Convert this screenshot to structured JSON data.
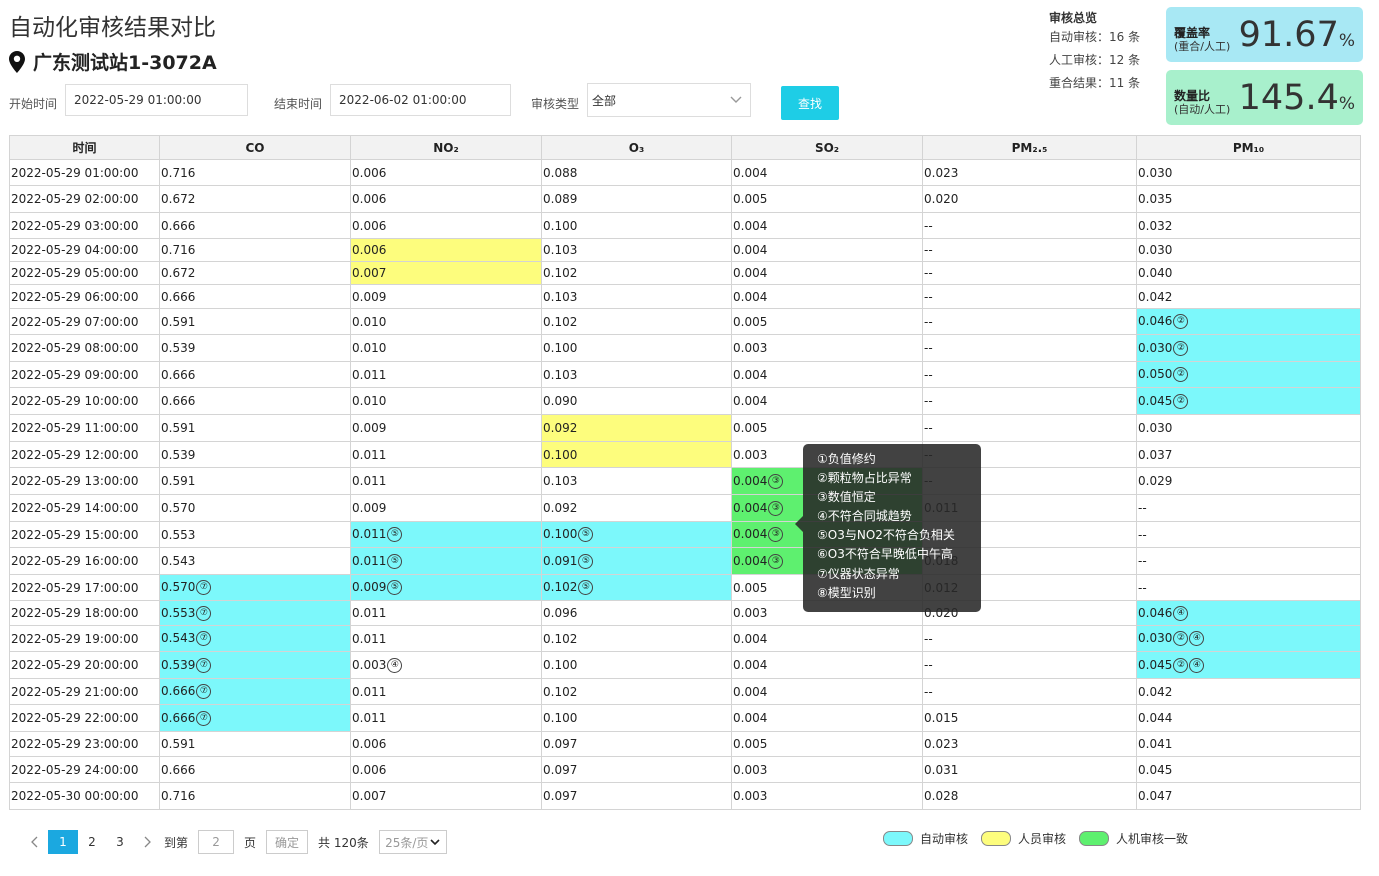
{
  "header": {
    "title": "自动化审核结果对比",
    "station": "广东测试站1-3072A"
  },
  "filters": {
    "start_label": "开始时间",
    "start_value": "2022-05-29 01:00:00",
    "end_label": "结束时间",
    "end_value": "2022-06-02 01:00:00",
    "type_label": "审核类型",
    "type_value": "全部",
    "search_label": "查找"
  },
  "summary": {
    "heading": "审核总览",
    "auto": "自动审核：16 条",
    "manual": "人工审核：12 条",
    "overlap": "重合结果：11 条"
  },
  "cards": {
    "coverage_label": "覆盖率",
    "coverage_sub": "(重合/人工)",
    "coverage_value": "91.67",
    "coverage_unit": "%",
    "coverage_color": "#a8e8f4",
    "ratio_label": "数量比",
    "ratio_sub": "(自动/人工)",
    "ratio_value": "145.4",
    "ratio_unit": "%",
    "ratio_color": "#a8f0cc"
  },
  "table": {
    "columns": [
      "时间",
      "CO",
      "NO₂",
      "O₃",
      "SO₂",
      "PM₂.₅",
      "PM₁₀"
    ],
    "rows": [
      {
        "time": "2022-05-29 01:00:00",
        "cells": [
          [
            "0.716",
            "",
            []
          ],
          [
            "0.006",
            "",
            []
          ],
          [
            "0.088",
            "",
            []
          ],
          [
            "0.004",
            "",
            []
          ],
          [
            "0.023",
            "",
            []
          ],
          [
            "0.030",
            "",
            []
          ]
        ]
      },
      {
        "time": "2022-05-29 02:00:00",
        "cells": [
          [
            "0.672",
            "",
            []
          ],
          [
            "0.006",
            "",
            []
          ],
          [
            "0.089",
            "",
            []
          ],
          [
            "0.005",
            "",
            []
          ],
          [
            "0.020",
            "",
            []
          ],
          [
            "0.035",
            "",
            []
          ]
        ]
      },
      {
        "time": "2022-05-29 03:00:00",
        "cells": [
          [
            "0.666",
            "",
            []
          ],
          [
            "0.006",
            "",
            []
          ],
          [
            "0.100",
            "",
            []
          ],
          [
            "0.004",
            "",
            []
          ],
          [
            "--",
            "",
            []
          ],
          [
            "0.032",
            "",
            []
          ]
        ]
      },
      {
        "time": "2022-05-29 04:00:00",
        "cells": [
          [
            "0.716",
            "",
            []
          ],
          [
            "0.006",
            "y",
            []
          ],
          [
            "0.103",
            "",
            []
          ],
          [
            "0.004",
            "",
            []
          ],
          [
            "--",
            "",
            []
          ],
          [
            "0.030",
            "",
            []
          ]
        ]
      },
      {
        "time": "2022-05-29 05:00:00",
        "cells": [
          [
            "0.672",
            "",
            []
          ],
          [
            "0.007",
            "y",
            []
          ],
          [
            "0.102",
            "",
            []
          ],
          [
            "0.004",
            "",
            []
          ],
          [
            "--",
            "",
            []
          ],
          [
            "0.040",
            "",
            []
          ]
        ]
      },
      {
        "time": "2022-05-29 06:00:00",
        "cells": [
          [
            "0.666",
            "",
            []
          ],
          [
            "0.009",
            "",
            []
          ],
          [
            "0.103",
            "",
            []
          ],
          [
            "0.004",
            "",
            []
          ],
          [
            "--",
            "",
            []
          ],
          [
            "0.042",
            "",
            []
          ]
        ]
      },
      {
        "time": "2022-05-29 07:00:00",
        "cells": [
          [
            "0.591",
            "",
            []
          ],
          [
            "0.010",
            "",
            []
          ],
          [
            "0.102",
            "",
            []
          ],
          [
            "0.005",
            "",
            []
          ],
          [
            "--",
            "",
            []
          ],
          [
            "0.046",
            "c",
            [
              "②"
            ]
          ]
        ]
      },
      {
        "time": "2022-05-29 08:00:00",
        "cells": [
          [
            "0.539",
            "",
            []
          ],
          [
            "0.010",
            "",
            []
          ],
          [
            "0.100",
            "",
            []
          ],
          [
            "0.003",
            "",
            []
          ],
          [
            "--",
            "",
            []
          ],
          [
            "0.030",
            "c",
            [
              "②"
            ]
          ]
        ]
      },
      {
        "time": "2022-05-29 09:00:00",
        "cells": [
          [
            "0.666",
            "",
            []
          ],
          [
            "0.011",
            "",
            []
          ],
          [
            "0.103",
            "",
            []
          ],
          [
            "0.004",
            "",
            []
          ],
          [
            "--",
            "",
            []
          ],
          [
            "0.050",
            "c",
            [
              "②"
            ]
          ]
        ]
      },
      {
        "time": "2022-05-29 10:00:00",
        "cells": [
          [
            "0.666",
            "",
            []
          ],
          [
            "0.010",
            "",
            []
          ],
          [
            "0.090",
            "",
            []
          ],
          [
            "0.004",
            "",
            []
          ],
          [
            "--",
            "",
            []
          ],
          [
            "0.045",
            "c",
            [
              "②"
            ]
          ]
        ]
      },
      {
        "time": "2022-05-29 11:00:00",
        "cells": [
          [
            "0.591",
            "",
            []
          ],
          [
            "0.009",
            "",
            []
          ],
          [
            "0.092",
            "y",
            []
          ],
          [
            "0.005",
            "",
            []
          ],
          [
            "--",
            "",
            []
          ],
          [
            "0.030",
            "",
            []
          ]
        ]
      },
      {
        "time": "2022-05-29 12:00:00",
        "cells": [
          [
            "0.539",
            "",
            []
          ],
          [
            "0.011",
            "",
            []
          ],
          [
            "0.100",
            "y",
            []
          ],
          [
            "0.003",
            "",
            []
          ],
          [
            "--",
            "",
            []
          ],
          [
            "0.037",
            "",
            []
          ]
        ]
      },
      {
        "time": "2022-05-29 13:00:00",
        "cells": [
          [
            "0.591",
            "",
            []
          ],
          [
            "0.011",
            "",
            []
          ],
          [
            "0.103",
            "",
            []
          ],
          [
            "0.004",
            "g",
            [
              "③"
            ]
          ],
          [
            "--",
            "",
            []
          ],
          [
            "0.029",
            "",
            []
          ]
        ]
      },
      {
        "time": "2022-05-29 14:00:00",
        "cells": [
          [
            "0.570",
            "",
            []
          ],
          [
            "0.009",
            "",
            []
          ],
          [
            "0.092",
            "",
            []
          ],
          [
            "0.004",
            "g",
            [
              "③"
            ]
          ],
          [
            "0.011",
            "",
            []
          ],
          [
            "--",
            "",
            []
          ]
        ]
      },
      {
        "time": "2022-05-29 15:00:00",
        "cells": [
          [
            "0.553",
            "",
            []
          ],
          [
            "0.011",
            "c",
            [
              "⑤"
            ]
          ],
          [
            "0.100",
            "c",
            [
              "⑤"
            ]
          ],
          [
            "0.004",
            "g",
            [
              "③"
            ]
          ],
          [
            "--",
            "",
            []
          ],
          [
            "--",
            "",
            []
          ]
        ]
      },
      {
        "time": "2022-05-29 16:00:00",
        "cells": [
          [
            "0.543",
            "",
            []
          ],
          [
            "0.011",
            "c",
            [
              "⑤"
            ]
          ],
          [
            "0.091",
            "c",
            [
              "⑤"
            ]
          ],
          [
            "0.004",
            "g",
            [
              "③"
            ]
          ],
          [
            "0.018",
            "",
            []
          ],
          [
            "--",
            "",
            []
          ]
        ]
      },
      {
        "time": "2022-05-29 17:00:00",
        "cells": [
          [
            "0.570",
            "c",
            [
              "⑦"
            ]
          ],
          [
            "0.009",
            "c",
            [
              "⑤"
            ]
          ],
          [
            "0.102",
            "c",
            [
              "⑤"
            ]
          ],
          [
            "0.005",
            "",
            []
          ],
          [
            "0.012",
            "",
            []
          ],
          [
            "--",
            "",
            []
          ]
        ]
      },
      {
        "time": "2022-05-29 18:00:00",
        "cells": [
          [
            "0.553",
            "c",
            [
              "⑦"
            ]
          ],
          [
            "0.011",
            "",
            []
          ],
          [
            "0.096",
            "",
            []
          ],
          [
            "0.003",
            "",
            []
          ],
          [
            "0.020",
            "",
            []
          ],
          [
            "0.046",
            "c",
            [
              "④"
            ]
          ]
        ]
      },
      {
        "time": "2022-05-29 19:00:00",
        "cells": [
          [
            "0.543",
            "c",
            [
              "⑦"
            ]
          ],
          [
            "0.011",
            "",
            []
          ],
          [
            "0.102",
            "",
            []
          ],
          [
            "0.004",
            "",
            []
          ],
          [
            "--",
            "",
            []
          ],
          [
            "0.030",
            "c",
            [
              "②",
              "④"
            ]
          ]
        ]
      },
      {
        "time": "2022-05-29 20:00:00",
        "cells": [
          [
            "0.539",
            "c",
            [
              "⑦"
            ]
          ],
          [
            "0.003",
            "",
            [
              "④"
            ]
          ],
          [
            "0.100",
            "",
            []
          ],
          [
            "0.004",
            "",
            []
          ],
          [
            "--",
            "",
            []
          ],
          [
            "0.045",
            "c",
            [
              "②",
              "④"
            ]
          ]
        ]
      },
      {
        "time": "2022-05-29 21:00:00",
        "cells": [
          [
            "0.666",
            "c",
            [
              "⑦"
            ]
          ],
          [
            "0.011",
            "",
            []
          ],
          [
            "0.102",
            "",
            []
          ],
          [
            "0.004",
            "",
            []
          ],
          [
            "--",
            "",
            []
          ],
          [
            "0.042",
            "",
            []
          ]
        ]
      },
      {
        "time": "2022-05-29 22:00:00",
        "cells": [
          [
            "0.666",
            "c",
            [
              "⑦"
            ]
          ],
          [
            "0.011",
            "",
            []
          ],
          [
            "0.100",
            "",
            []
          ],
          [
            "0.004",
            "",
            []
          ],
          [
            "0.015",
            "",
            []
          ],
          [
            "0.044",
            "",
            []
          ]
        ]
      },
      {
        "time": "2022-05-29 23:00:00",
        "cells": [
          [
            "0.591",
            "",
            []
          ],
          [
            "0.006",
            "",
            []
          ],
          [
            "0.097",
            "",
            []
          ],
          [
            "0.005",
            "",
            []
          ],
          [
            "0.023",
            "",
            []
          ],
          [
            "0.041",
            "",
            []
          ]
        ]
      },
      {
        "time": "2022-05-29 24:00:00",
        "cells": [
          [
            "0.666",
            "",
            []
          ],
          [
            "0.006",
            "",
            []
          ],
          [
            "0.097",
            "",
            []
          ],
          [
            "0.003",
            "",
            []
          ],
          [
            "0.031",
            "",
            []
          ],
          [
            "0.045",
            "",
            []
          ]
        ]
      },
      {
        "time": "2022-05-30 00:00:00",
        "cells": [
          [
            "0.716",
            "",
            []
          ],
          [
            "0.007",
            "",
            []
          ],
          [
            "0.097",
            "",
            []
          ],
          [
            "0.003",
            "",
            []
          ],
          [
            "0.028",
            "",
            []
          ],
          [
            "0.047",
            "",
            []
          ]
        ]
      }
    ]
  },
  "tooltip": {
    "items": [
      "①负值修约",
      "②颗粒物占比异常",
      "③数值恒定",
      "④不符合同城趋势",
      "⑤O3与NO2不符合负相关",
      "⑥O3不符合早晚低中午高",
      "⑦仪器状态异常",
      "⑧模型识别"
    ]
  },
  "pager": {
    "prev": "<",
    "pages": [
      "1",
      "2",
      "3"
    ],
    "next": ">",
    "goto_label": "到第",
    "goto_value": "2",
    "page_unit": "页",
    "confirm": "确定",
    "total": "共 120条",
    "page_size": "25条/页"
  },
  "legend": [
    {
      "label": "自动审核",
      "color": "#7cf8fb"
    },
    {
      "label": "人员审核",
      "color": "#fdfd7d"
    },
    {
      "label": "人机审核一致",
      "color": "#5ef06f"
    }
  ]
}
